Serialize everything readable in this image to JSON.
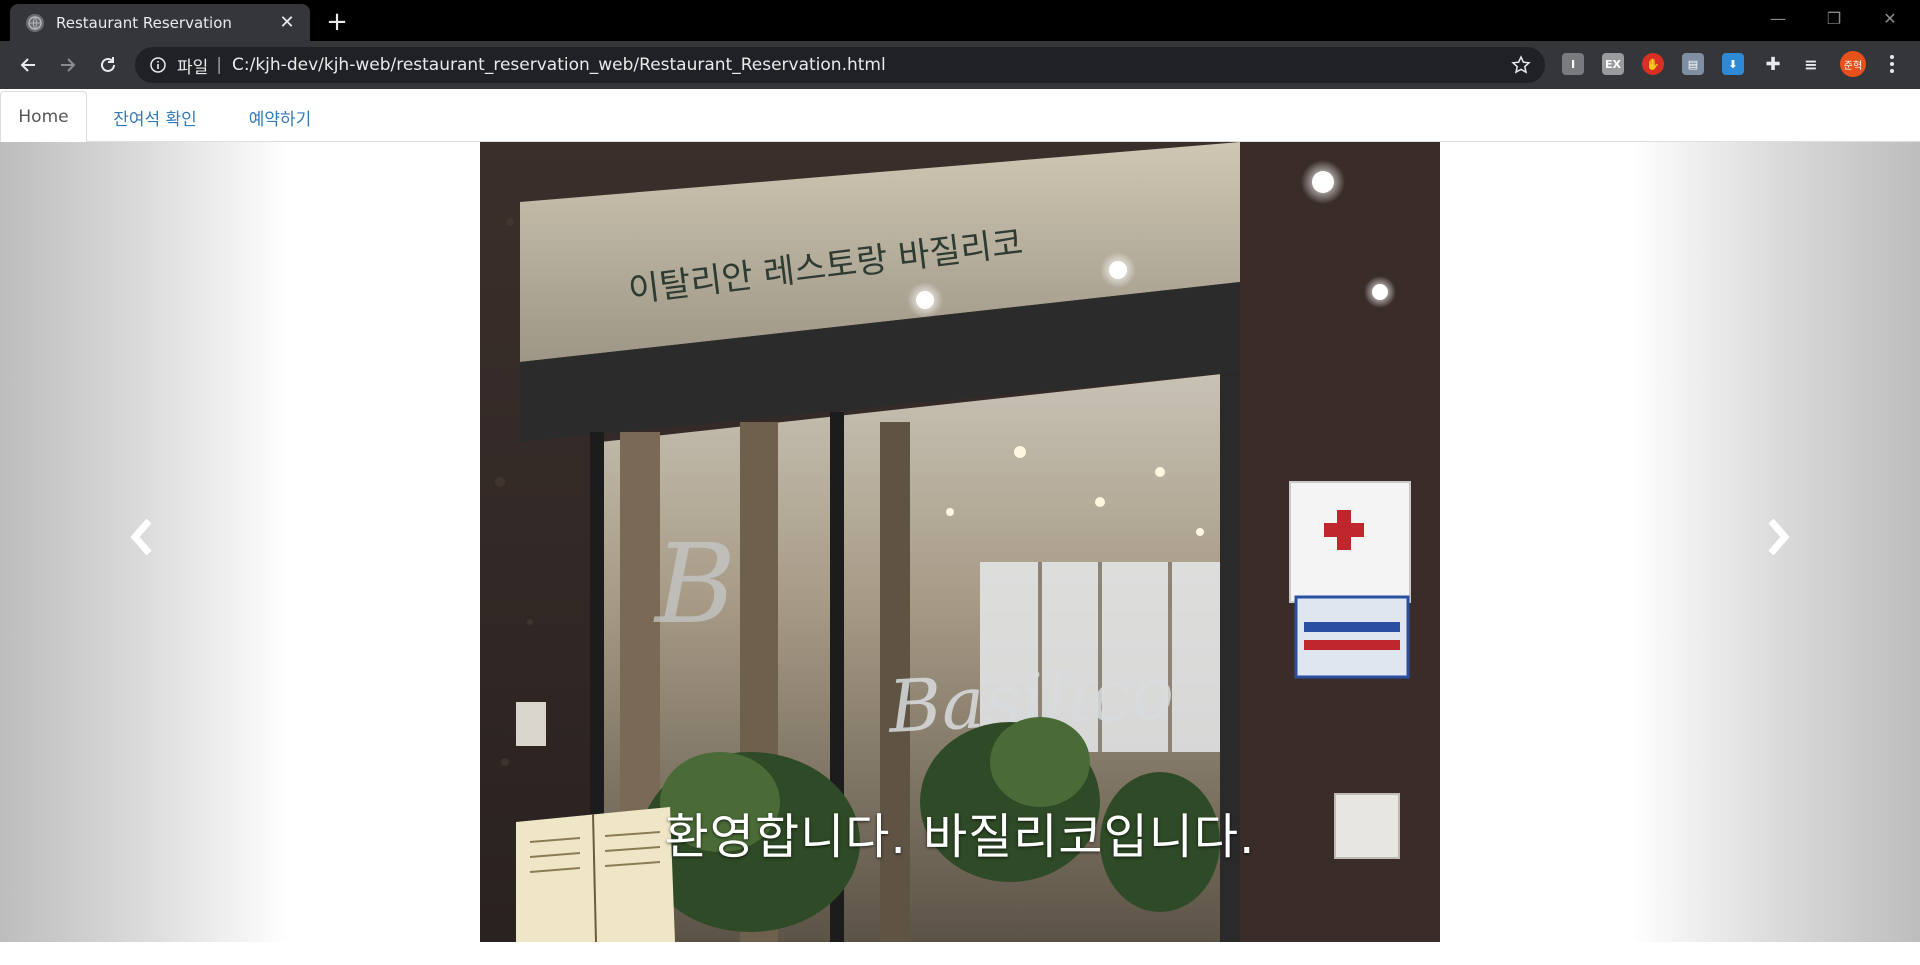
{
  "browser": {
    "tab_title": "Restaurant Reservation",
    "omnibox_scheme": "파일",
    "omnibox_url": "C:/kjh-dev/kjh-web/restaurant_reservation_web/Restaurant_Reservation.html",
    "profile_initials": "준혁",
    "extension_ex_label": "EX"
  },
  "nav": {
    "items": [
      {
        "label": "Home"
      },
      {
        "label": "잔여석 확인"
      },
      {
        "label": "예약하기"
      }
    ]
  },
  "carousel": {
    "caption": "환영합니다. 바질리코입니다.",
    "photo_sign_korean": "이탈리안 레스토랑  바질리코",
    "photo_glass_text": "Basilico"
  }
}
